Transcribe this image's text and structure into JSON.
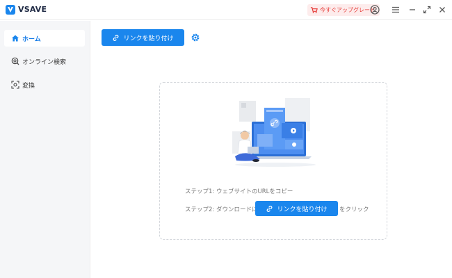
{
  "app": {
    "name": "VSAVE",
    "brand_color": "#1a86ed",
    "upgrade_label": "今すぐアップグレード",
    "upgrade_color": "#e53935"
  },
  "titlebar": {
    "icons": [
      "cart-icon",
      "user-icon",
      "menu-icon",
      "minimize-icon",
      "maximize-icon",
      "close-icon"
    ]
  },
  "sidebar": {
    "items": [
      {
        "label": "ホーム",
        "icon": "home-icon",
        "active": true
      },
      {
        "label": "オンライン検索",
        "icon": "search-icon",
        "active": false
      },
      {
        "label": "変換",
        "icon": "convert-icon",
        "active": false
      }
    ]
  },
  "main": {
    "paste_button_label": "リンクを貼り付け",
    "settings_icon": "gear-icon",
    "step1": "ステップ1: ウェブサイトのURLをコピー",
    "step2_prefix": "ステップ2: ダウンロードには",
    "step2_button_label": "リンクを貼り付け",
    "step2_suffix": "をクリック"
  }
}
